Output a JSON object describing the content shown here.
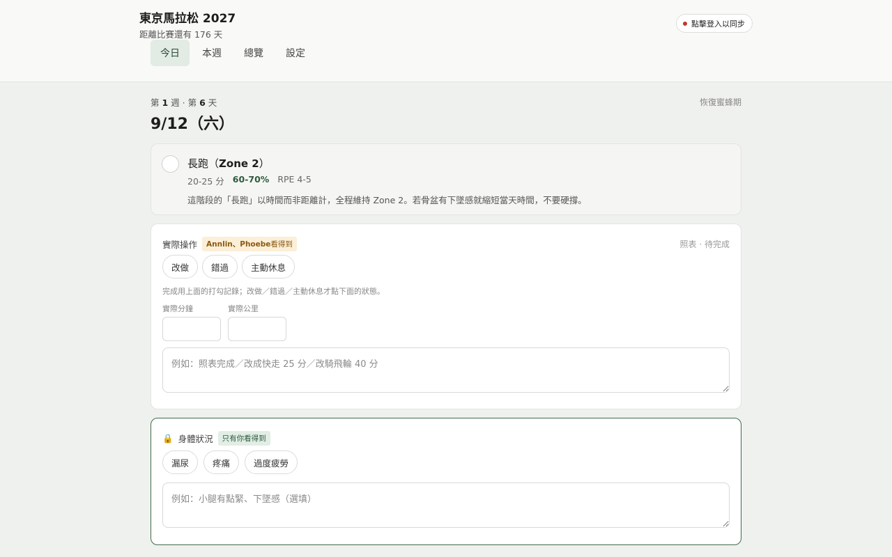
{
  "header": {
    "title": "東京馬拉松 2027",
    "countdown": "距離比賽還有 176 天",
    "sync_label": "點擊登入以同步",
    "sync_dot_color": "#c0392b",
    "tabs": [
      {
        "label": "今日",
        "active": true
      },
      {
        "label": "本週",
        "active": false
      },
      {
        "label": "總覽",
        "active": false
      },
      {
        "label": "設定",
        "active": false
      }
    ]
  },
  "day": {
    "week_prefix": "第 ",
    "week_num": "1",
    "week_mid": " 週 · 第 ",
    "day_num": "6",
    "day_suffix": " 天",
    "recover_label": "恢復蜜蜂期",
    "date": "9/12（六）"
  },
  "plan": {
    "title_prefix": "長跑（",
    "title_zone": "Zone 2",
    "title_suffix": "）",
    "duration": "20-25 分",
    "intensity": "60-70%",
    "rpe": "RPE 4-5",
    "description": "這階段的「長跑」以時間而非距離計，全程維持 Zone 2。若骨盆有下墜感就縮短當天時間，不要硬撐。"
  },
  "actual": {
    "label": "實際操作",
    "visibility_names": "Annlin、Phoebe",
    "visibility_suffix": "看得到",
    "status": "照表 · 待完成",
    "options": [
      "改做",
      "錯過",
      "主動休息"
    ],
    "hint": "完成用上面的打勾記錄；改做／錯過／主動休息才點下面的狀態。",
    "minutes_label": "實際分鐘",
    "km_label": "實際公里",
    "note_placeholder": "例如：照表完成／改成快走 25 分／改騎飛輪 40 分"
  },
  "body": {
    "lock_icon": "🔒",
    "label": "身體狀況",
    "visibility": "只有你看得到",
    "options": [
      "漏尿",
      "疼痛",
      "過度疲勞"
    ],
    "note_placeholder": "例如：小腿有點緊、下墜感（選填）"
  },
  "colors": {
    "accent": "#2d5a3d",
    "tab_active_bg": "#e2ebe4",
    "badge_yellow_bg": "#fbefd7"
  }
}
